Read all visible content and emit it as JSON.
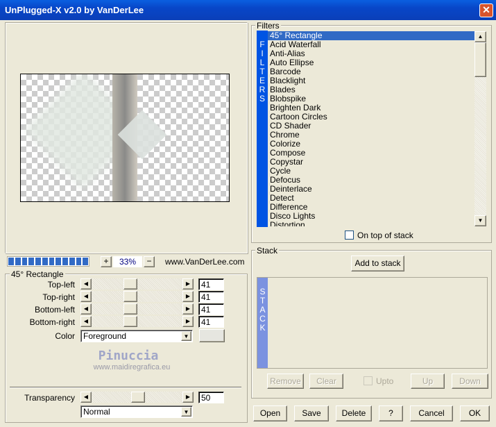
{
  "window": {
    "title": "UnPlugged-X v2.0 by VanDerLee",
    "close_label": "✕"
  },
  "preview": {
    "zoom": "33%",
    "plus": "+",
    "minus": "−",
    "url": "www.VanDerLee.com",
    "progress_segments": 12
  },
  "settings": {
    "group_label": "45° Rectangle",
    "rows": [
      {
        "label": "Top-left",
        "value": "41"
      },
      {
        "label": "Top-right",
        "value": "41"
      },
      {
        "label": "Bottom-left",
        "value": "41"
      },
      {
        "label": "Bottom-right",
        "value": "41"
      }
    ],
    "color_label": "Color",
    "color_value": "Foreground",
    "swatch_color": "#e6e6e0",
    "transparency_label": "Transparency",
    "transparency_value": "50",
    "blend_mode": "Normal"
  },
  "watermark": {
    "name": "Pinuccia",
    "url": "www.maidiregrafica.eu"
  },
  "filters": {
    "group_label": "Filters",
    "sidebar": "FILTERS",
    "selected": "45° Rectangle",
    "items": [
      "45° Rectangle",
      "Acid Waterfall",
      "Anti-Alias",
      "Auto Ellipse",
      "Barcode",
      "Blacklight",
      "Blades",
      "Blobspike",
      "Brighten Dark",
      "Cartoon Circles",
      "CD Shader",
      "Chrome",
      "Colorize",
      "Compose",
      "Copystar",
      "Cycle",
      "Defocus",
      "Deinterlace",
      "Detect",
      "Difference",
      "Disco Lights",
      "Distortion"
    ],
    "on_top_label": "On top of stack",
    "on_top_checked": false
  },
  "stack": {
    "group_label": "Stack",
    "add_label": "Add to stack",
    "sidebar": "STACK",
    "remove": "Remove",
    "clear": "Clear",
    "upto": "Upto",
    "up": "Up",
    "down": "Down"
  },
  "buttons": {
    "open": "Open",
    "save": "Save",
    "delete": "Delete",
    "help": "?",
    "cancel": "Cancel",
    "ok": "OK"
  },
  "colors": {
    "titlebar": "#0846c8",
    "selection": "#316ac5",
    "sidebar": "#0054e3"
  }
}
